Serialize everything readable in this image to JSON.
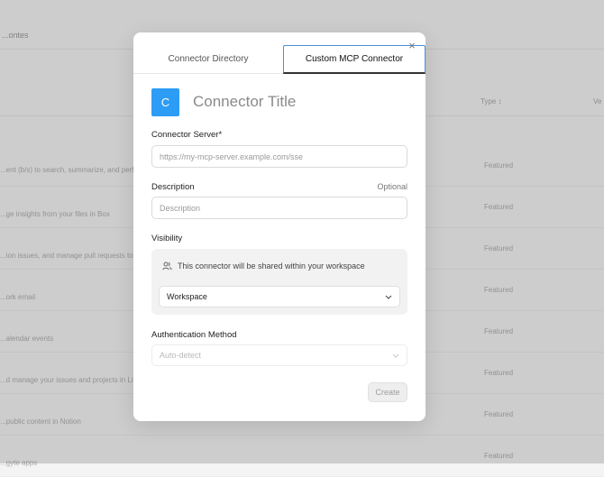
{
  "background": {
    "top_link": "...ontes",
    "columns": [
      "Type ↕",
      "Ve"
    ],
    "rows": [
      {
        "text": "...ent (b/s) to search, summarize, and perfor",
        "type": "Featured"
      },
      {
        "text": "...ge insights from your files in Box",
        "type": "Featured"
      },
      {
        "text": "...ion issues, and manage pull requests to",
        "type": "Featured"
      },
      {
        "text": "...ork email",
        "type": "Featured"
      },
      {
        "text": "...alendar events",
        "type": "Featured"
      },
      {
        "text": "...d manage your issues and projects in Line",
        "type": "Featured"
      },
      {
        "text": "...public content in Notion",
        "type": "Featured"
      },
      {
        "text": "...gyte apps",
        "type": "Featured"
      }
    ]
  },
  "modal": {
    "tabs": {
      "directory": "Connector Directory",
      "custom": "Custom MCP Connector"
    },
    "close_icon": "×",
    "icon_letter": "C",
    "title_placeholder": "Connector Title",
    "server": {
      "label": "Connector Server*",
      "placeholder": "https://my-mcp-server.example.com/sse"
    },
    "description": {
      "label": "Description",
      "optional": "Optional",
      "placeholder": "Description"
    },
    "visibility": {
      "label": "Visibility",
      "note": "This connector will be shared within your workspace",
      "selected": "Workspace"
    },
    "auth": {
      "label": "Authentication Method",
      "selected": "Auto-detect"
    },
    "create_label": "Create"
  }
}
